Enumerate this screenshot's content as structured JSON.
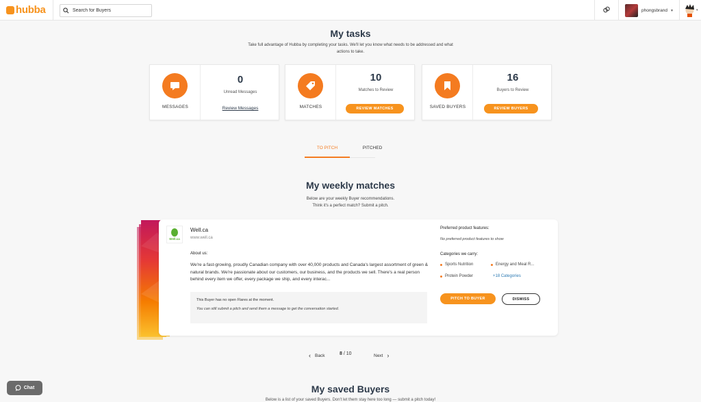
{
  "header": {
    "logo_text": "hubba",
    "search_placeholder": "Search for Buyers",
    "username": "phongsbrand",
    "caret": "▾",
    "icons": [
      "search-icon",
      "link-icon",
      "chevron-down-icon"
    ]
  },
  "tasks": {
    "title": "My tasks",
    "subtitle": "Take full advantage of Hubba by completing your tasks. We'll let you know what needs to be addressed and what actions to take.",
    "cards": [
      {
        "label": "MESSAGES",
        "icon": "message-icon",
        "count": "0",
        "desc": "Unread Messages",
        "action": "Review Messages"
      },
      {
        "label": "MATCHES",
        "icon": "tag-icon",
        "count": "10",
        "desc": "Matches to Review",
        "action": "REVIEW MATCHES"
      },
      {
        "label": "SAVED BUYERS",
        "icon": "bookmark-icon",
        "count": "16",
        "desc": "Buyers to Review",
        "action": "REVIEW BUYERS"
      }
    ]
  },
  "tabs": [
    {
      "label": "TO PITCH",
      "active": true
    },
    {
      "label": "PITCHED",
      "active": false
    }
  ],
  "weekly": {
    "title": "My weekly matches",
    "subtitle_line1": "Below are your weekly Buyer recommendations.",
    "subtitle_line2": "Think it's a perfect match? Submit a pitch.",
    "match": {
      "logo_text": "Well.ca",
      "name": "Well.ca",
      "url": "www.well.ca",
      "about_label": "About us:",
      "about": "We're a fast-growing, proudly Canadian company with over 40,000 products and Canada's largest assortment of green & natural brands. We're passionate about our customers, our business, and the products we sell. There's a real person behind every item we offer, every package we ship, and every interac...",
      "flares_title": "This Buyer has no open Flares at the moment.",
      "flares_note": "You can still submit a pitch and send them a message to get the conversation started.",
      "pref_label": "Preferred product features:",
      "pref_note": "No preferred product features to show",
      "categories_label": "Categories we carry:",
      "categories": [
        "Sports Nutrition",
        "Energy and Meal R...",
        "Protein Powder"
      ],
      "categories_more": "+18 Categories",
      "pitch_button": "PITCH TO BUYER",
      "dismiss_button": "DISMISS",
      "accent_colors": [
        "#d81b60",
        "#f4511e",
        "#fbc02d"
      ]
    },
    "pager": {
      "back": "Back",
      "next": "Next",
      "current": "8",
      "separator": " / ",
      "total": "10"
    }
  },
  "saved": {
    "title": "My saved Buyers",
    "subtitle": "Below is a list of your saved Buyers. Don't let them stay here too long — submit a pitch today!"
  },
  "chat": {
    "label": "Chat"
  },
  "colors": {
    "accent": "#f47b20",
    "button": "#f7931e",
    "heading": "#2d3a4a"
  }
}
